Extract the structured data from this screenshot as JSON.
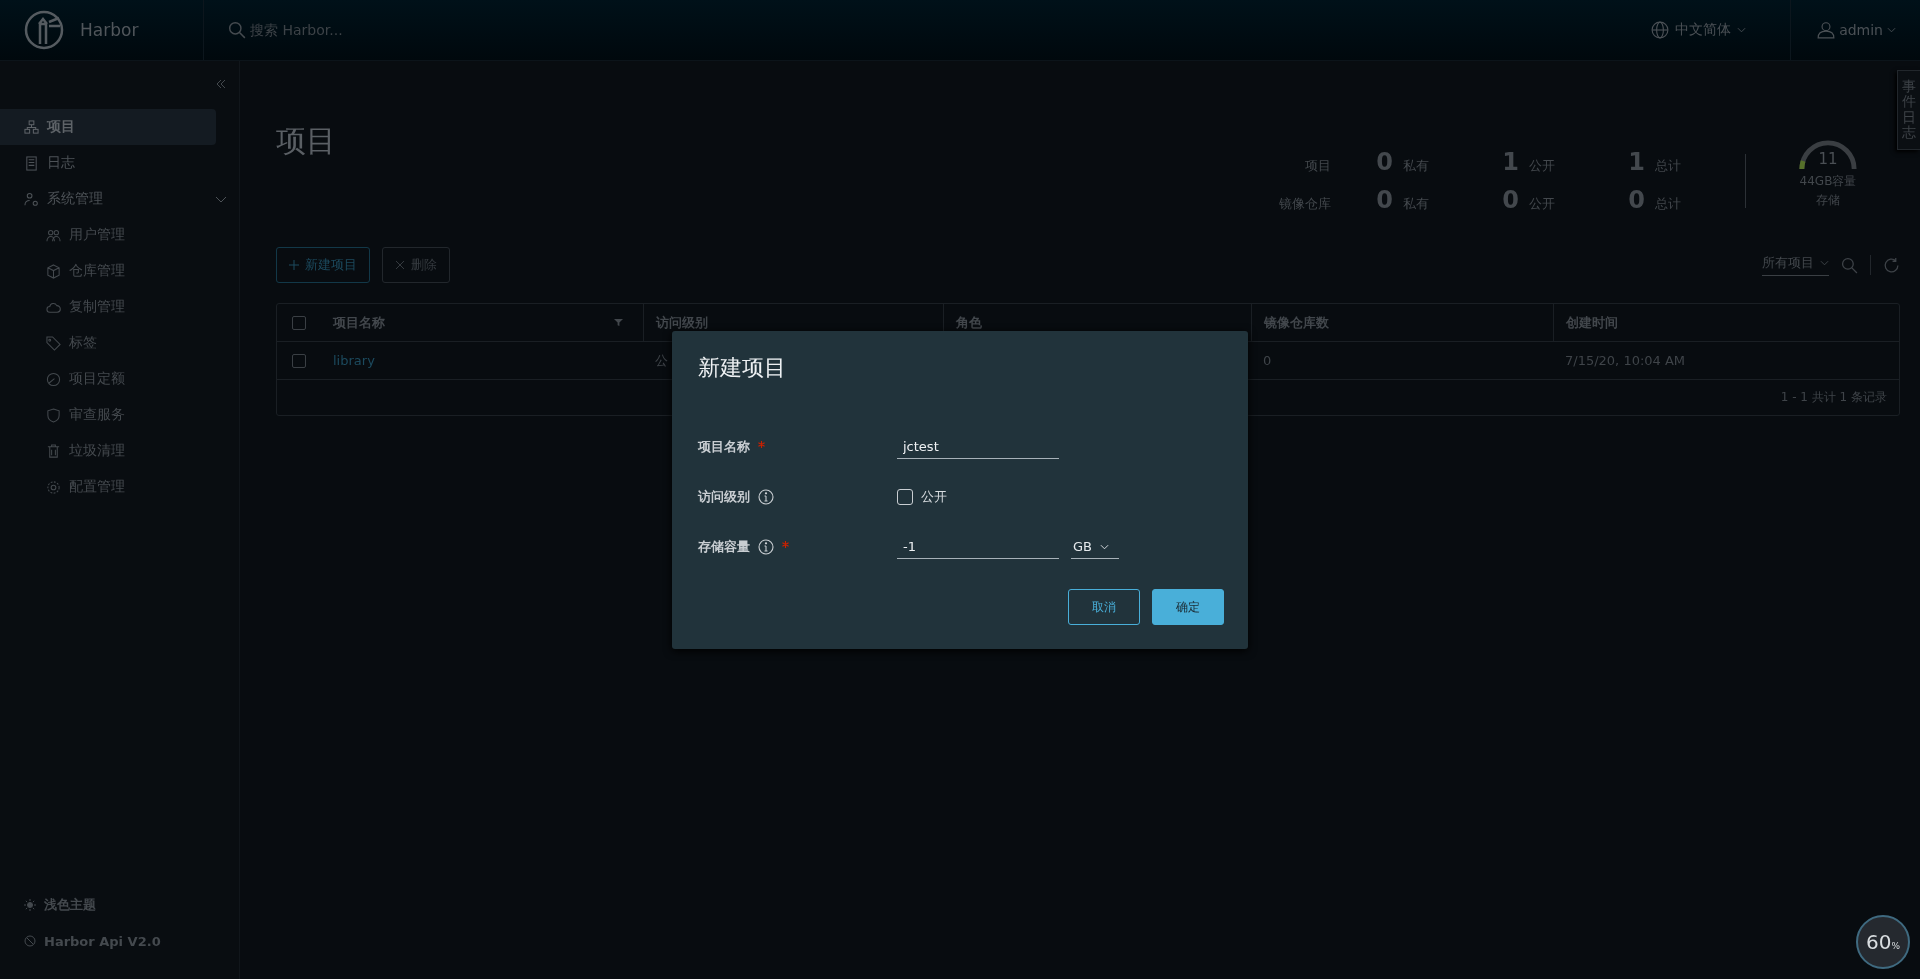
{
  "header": {
    "brand": "Harbor",
    "search": {
      "placeholder": "搜索 Harbor..."
    },
    "language": "中文简体",
    "user": "admin"
  },
  "sidebar": {
    "items": [
      {
        "label": "项目",
        "selected": true
      },
      {
        "label": "日志",
        "selected": false
      },
      {
        "label": "系统管理",
        "selected": false,
        "expanded": true,
        "children": [
          {
            "label": "用户管理",
            "selected": false
          },
          {
            "label": "仓库管理",
            "selected": false
          },
          {
            "label": "复制管理",
            "selected": false
          },
          {
            "label": "标签",
            "selected": false
          },
          {
            "label": "项目定额",
            "selected": false
          },
          {
            "label": "审查服务",
            "selected": false
          },
          {
            "label": "垃圾清理",
            "selected": false
          },
          {
            "label": "配置管理",
            "selected": false
          }
        ]
      }
    ],
    "footer": [
      "浅色主题",
      "Harbor Api V2.0"
    ]
  },
  "page": {
    "title": "项目",
    "stats": [
      {
        "label": "项目",
        "cells": [
          {
            "value": "0",
            "label": "私有"
          },
          {
            "value": "1",
            "label": "公开"
          },
          {
            "value": "1",
            "label": "总计"
          }
        ]
      },
      {
        "label": "镜像仓库",
        "cells": [
          {
            "value": "0",
            "label": "私有"
          },
          {
            "value": "0",
            "label": "公开"
          },
          {
            "value": "0",
            "label": "总计"
          }
        ]
      }
    ],
    "storage": {
      "value": "11",
      "caption": "44GB容量",
      "label": "存储",
      "level": 0.1
    },
    "toolbar": [
      {
        "label": "新建项目",
        "kind": "add",
        "disabled": false
      },
      {
        "label": "删除",
        "kind": "delete",
        "disabled": true
      }
    ],
    "filter": "所有项目",
    "table": {
      "columns": [
        "项目名称",
        "访问级别",
        "角色",
        "镜像仓库数",
        "创建时间"
      ],
      "all_selected": false,
      "rows": [
        {
          "selected": false,
          "name": "library",
          "access": "公",
          "repo_count": "0",
          "created": "7/15/20, 10:04 AM"
        }
      ],
      "footer": "1 - 1 共计 1 条记录"
    }
  },
  "event_tab": "事件日志",
  "corner_badge": {
    "value": "60",
    "unit": "%"
  },
  "dialog": {
    "title": "新建项目",
    "fields": [
      {
        "kind": "text",
        "label": "项目名称",
        "required": true,
        "info": false,
        "value": "jctest"
      },
      {
        "kind": "checkbox",
        "label": "访问级别",
        "required": false,
        "info": true,
        "checked": false,
        "option": "公开"
      },
      {
        "kind": "quota",
        "label": "存储容量",
        "required": true,
        "info": true,
        "value": "-1",
        "unit": "GB"
      }
    ],
    "buttons": [
      {
        "label": "取消",
        "kind": "secondary"
      },
      {
        "label": "确定",
        "kind": "primary"
      }
    ]
  }
}
